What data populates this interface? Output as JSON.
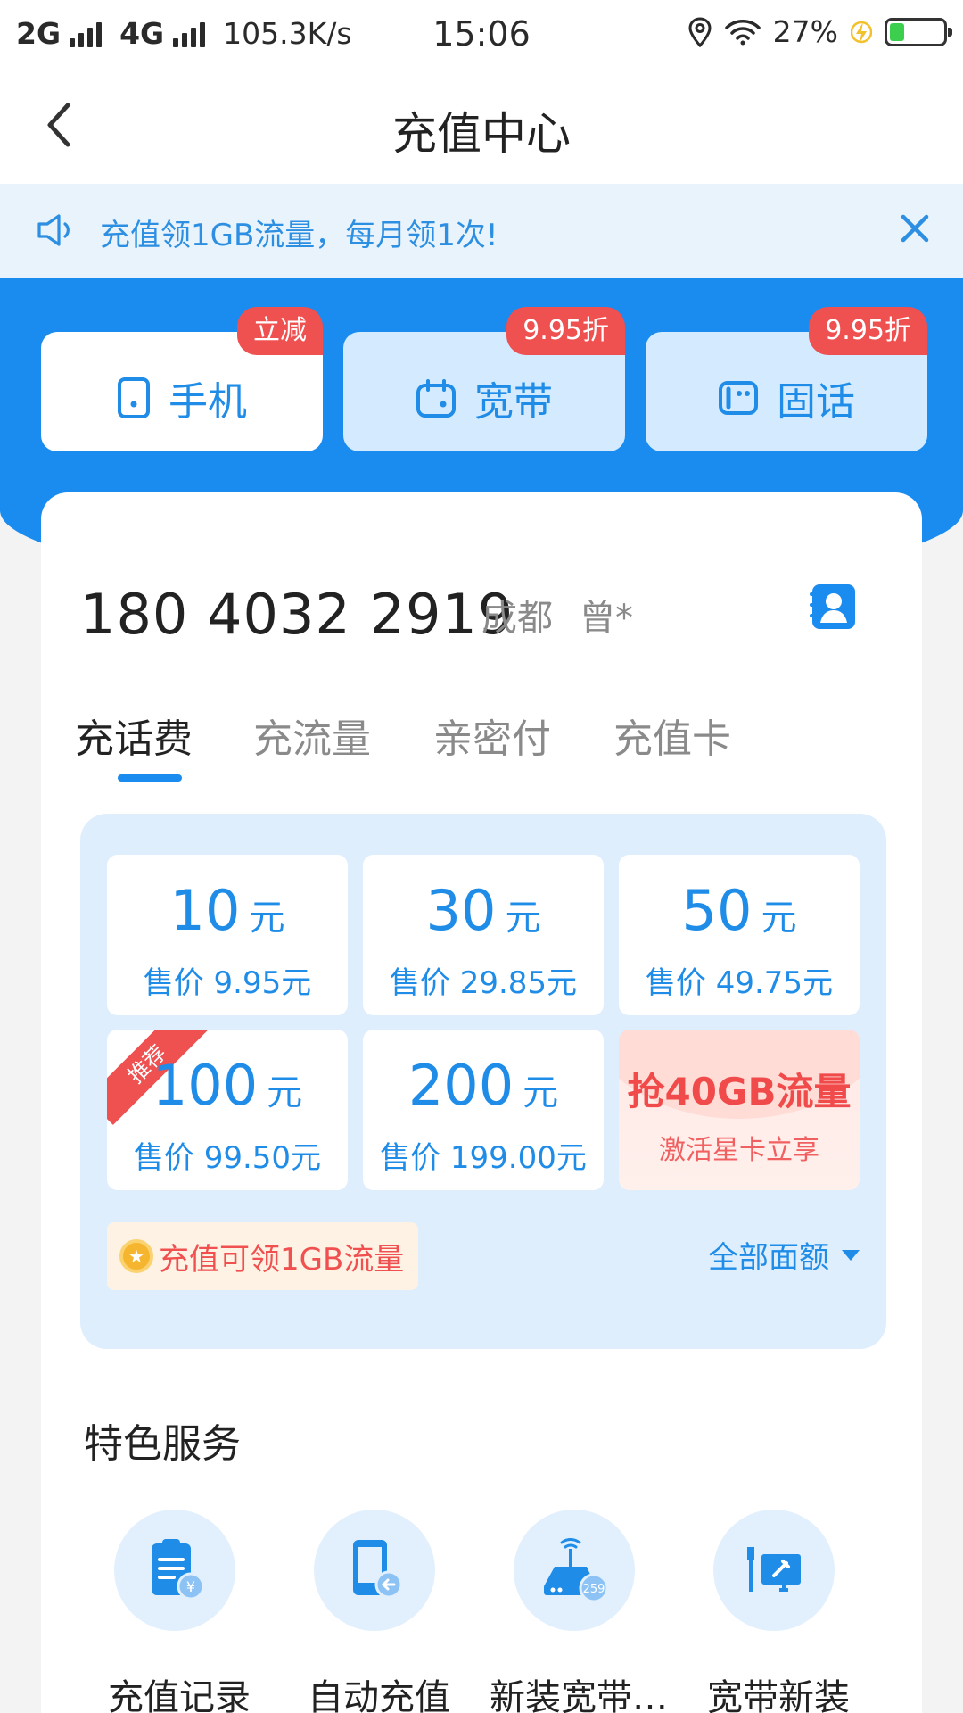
{
  "status_bar": {
    "network_2g": "2G",
    "network_4g": "4G",
    "speed": "105.3K/s",
    "time": "15:06",
    "battery": "27%"
  },
  "header": {
    "title": "充值中心"
  },
  "notice": {
    "text": "充值领1GB流量，每月领1次!"
  },
  "categories": [
    {
      "label": "手机",
      "badge": "立减",
      "icon": "phone-icon",
      "active": true
    },
    {
      "label": "宽带",
      "badge": "9.95折",
      "icon": "broadband-icon",
      "active": false
    },
    {
      "label": "固话",
      "badge": "9.95折",
      "icon": "landline-icon",
      "active": false
    }
  ],
  "account": {
    "phone": "180 4032 2919",
    "city": "成都",
    "name": "曾*"
  },
  "tabs": [
    {
      "label": "充话费",
      "active": true
    },
    {
      "label": "充流量"
    },
    {
      "label": "亲密付"
    },
    {
      "label": "充值卡"
    }
  ],
  "amounts": [
    {
      "value": "10",
      "unit": "元",
      "price": "售价 9.95元"
    },
    {
      "value": "30",
      "unit": "元",
      "price": "售价 29.85元"
    },
    {
      "value": "50",
      "unit": "元",
      "price": "售价 49.75元"
    },
    {
      "value": "100",
      "unit": "元",
      "price": "售价 99.50元",
      "ribbon": "推荐"
    },
    {
      "value": "200",
      "unit": "元",
      "price": "售价 199.00元"
    }
  ],
  "promo": {
    "title": "抢40GB流量",
    "subtitle": "激活星卡立享"
  },
  "tip": {
    "text": "充值可领1GB流量"
  },
  "all_amounts": "全部面额",
  "services": {
    "title": "特色服务",
    "items": [
      {
        "label": "充值记录",
        "icon": "recharge-record-icon"
      },
      {
        "label": "自动充值",
        "icon": "auto-recharge-icon"
      },
      {
        "label": "新装宽带…",
        "icon": "new-broadband-icon",
        "icon_badge": "259"
      },
      {
        "label": "宽带新装",
        "icon": "broadband-install-icon"
      }
    ]
  },
  "colors": {
    "primary": "#1a8cf0",
    "accent_red": "#ef5050",
    "panel_bg": "#deeefd"
  }
}
